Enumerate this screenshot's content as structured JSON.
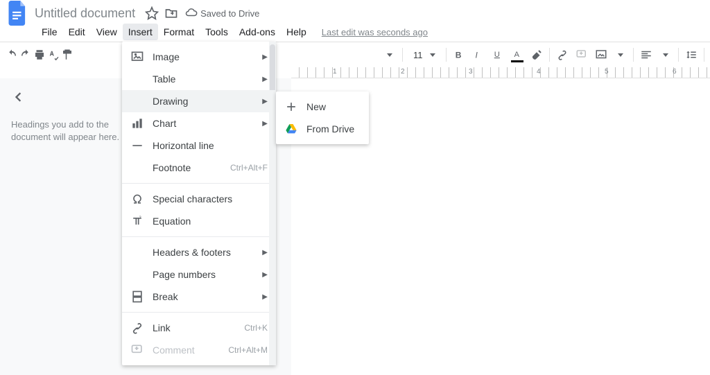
{
  "header": {
    "title": "Untitled document",
    "saved": "Saved to Drive"
  },
  "menubar": {
    "file": "File",
    "edit": "Edit",
    "view": "View",
    "insert": "Insert",
    "format": "Format",
    "tools": "Tools",
    "addons": "Add-ons",
    "help": "Help",
    "last_edit": "Last edit was seconds ago"
  },
  "toolbar": {
    "font_size": "11"
  },
  "ruler": {
    "nums": [
      "1",
      "2",
      "3",
      "4",
      "5",
      "6"
    ]
  },
  "outline": {
    "text": "Headings you add to the document will appear here."
  },
  "insert_menu": {
    "image": "Image",
    "table": "Table",
    "drawing": "Drawing",
    "chart": "Chart",
    "horizontal_line": "Horizontal line",
    "footnote": "Footnote",
    "footnote_sc": "Ctrl+Alt+F",
    "special_chars": "Special characters",
    "equation": "Equation",
    "headers_footers": "Headers & footers",
    "page_numbers": "Page numbers",
    "break": "Break",
    "link": "Link",
    "link_sc": "Ctrl+K",
    "comment": "Comment",
    "comment_sc": "Ctrl+Alt+M"
  },
  "drawing_submenu": {
    "new": "New",
    "from_drive": "From Drive"
  }
}
